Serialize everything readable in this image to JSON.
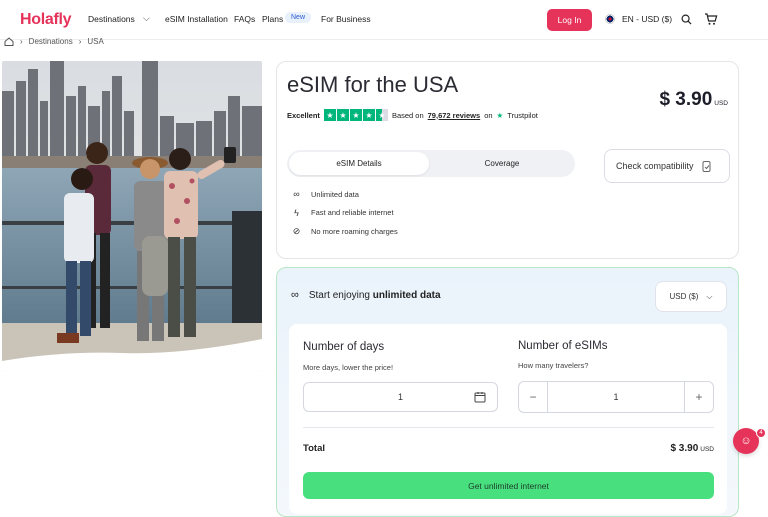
{
  "header": {
    "logo": "Holafly",
    "nav": [
      "Destinations",
      "eSIM Installation",
      "FAQs",
      "Plans",
      "For Business"
    ],
    "new_badge": "New",
    "login": "Log In",
    "language": "EN - USD ($)",
    "icons": [
      "search-icon",
      "cart-icon",
      "chevron-down-icon",
      "uk-flag-icon"
    ]
  },
  "breadcrumb": [
    "home-icon",
    "Destinations",
    "USA"
  ],
  "product": {
    "title": "eSIM for the USA",
    "price": "$ 3.90",
    "price_currency": "USD",
    "rating_word": "Excellent",
    "rating_stars": 4.5,
    "based_on": "Based on",
    "reviews_link": "79,672 reviews",
    "on": "on",
    "trustpilot": "Trustpilot",
    "tab_active": "eSIM Details",
    "tab_inactive": "Coverage",
    "check_button": "Check compatibility",
    "features": [
      {
        "icon": "infinity-icon",
        "text": "Unlimited data"
      },
      {
        "icon": "bolt-icon",
        "text": "Fast and reliable internet"
      },
      {
        "icon": "no-roaming-icon",
        "text": "No more roaming charges"
      }
    ]
  },
  "plan": {
    "heading_pre": "Start enjoying",
    "heading_bold": "unlimited data",
    "currency_select": "USD ($)",
    "days_label": "Number of days",
    "days_sub": "More days, lower the price!",
    "days_value": "1",
    "esims_label": "Number of eSIMs",
    "esims_sub": "How many travelers?",
    "esims_value": "1",
    "minus": "−",
    "plus": "+",
    "total_label": "Total",
    "total_value": "$ 3.90",
    "total_currency": "USD",
    "cta": "Get unlimited internet"
  },
  "chat": {
    "badge": "4"
  },
  "colors": {
    "brand": "#e5335a",
    "cta": "#48e07e",
    "trustpilot": "#00b67a"
  }
}
